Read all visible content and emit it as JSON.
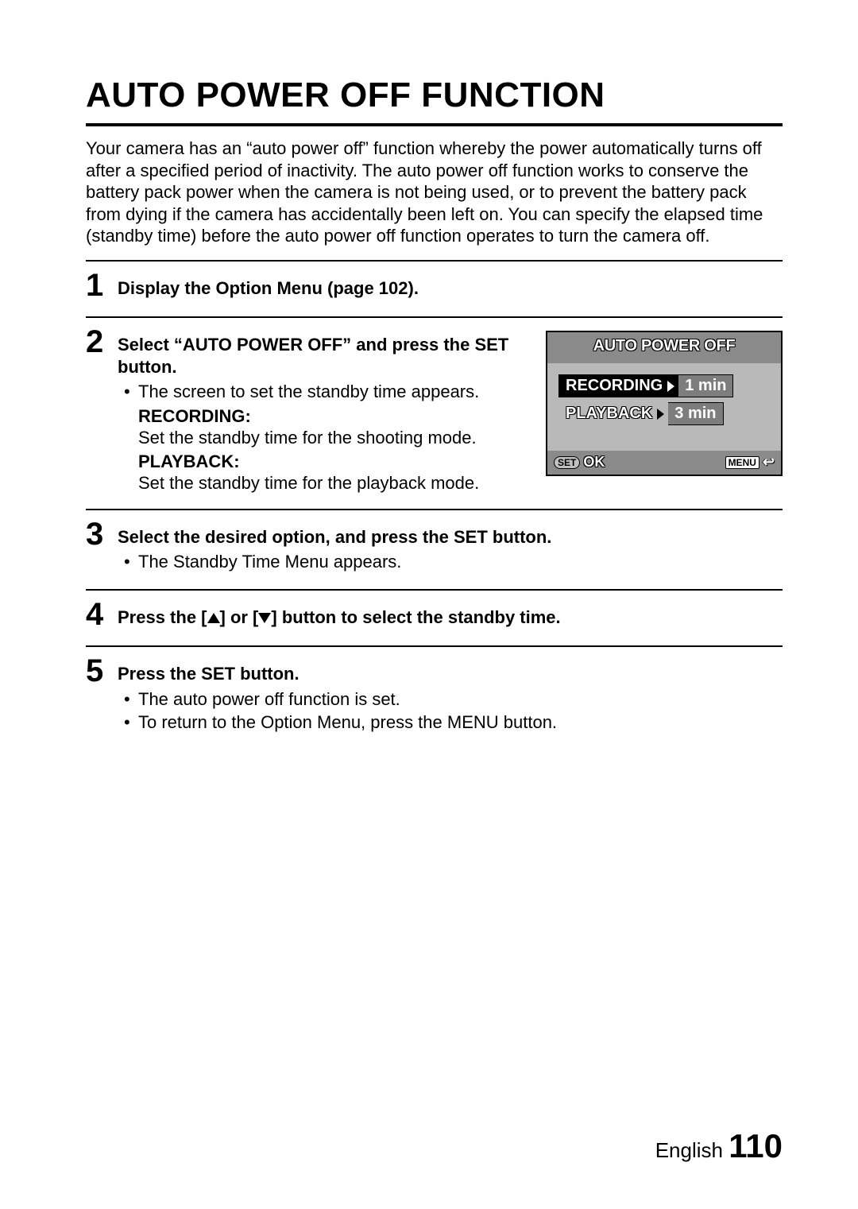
{
  "title": "AUTO POWER OFF FUNCTION",
  "intro": "Your camera has an “auto power off” function whereby the power automatically turns off after a specified period of inactivity. The auto power off function works to conserve the battery pack power when the camera is not being used, or to prevent the battery pack from dying if the camera has accidentally been left on. You can specify the elapsed time (standby time) before the auto power off function operates to turn the camera off.",
  "steps": {
    "s1": {
      "num": "1",
      "head": "Display the Option Menu (page 102)."
    },
    "s2": {
      "num": "2",
      "head": "Select “AUTO POWER OFF” and press the SET button.",
      "b1": "The screen to set the standby time appears.",
      "rec_label": "RECORDING:",
      "rec_text": "Set the standby time for the shooting mode.",
      "play_label": "PLAYBACK:",
      "play_text": "Set the standby time for the playback mode."
    },
    "s3": {
      "num": "3",
      "head": "Select the desired option, and press the SET button.",
      "b1": "The Standby Time Menu appears."
    },
    "s4": {
      "num": "4",
      "head_a": "Press the [",
      "head_b": "] or [",
      "head_c": "] button to select the standby time."
    },
    "s5": {
      "num": "5",
      "head": "Press the SET button.",
      "b1": "The auto power off function is set.",
      "b2": "To return to the Option Menu, press the MENU button."
    }
  },
  "lcd": {
    "title": "AUTO POWER OFF",
    "row1_label": "RECORDING",
    "row1_val": "1 min",
    "row2_label": "PLAYBACK",
    "row2_val": "3 min",
    "set": "SET",
    "ok": "OK",
    "menu": "MENU"
  },
  "footer": {
    "lang": "English",
    "page": "110"
  }
}
